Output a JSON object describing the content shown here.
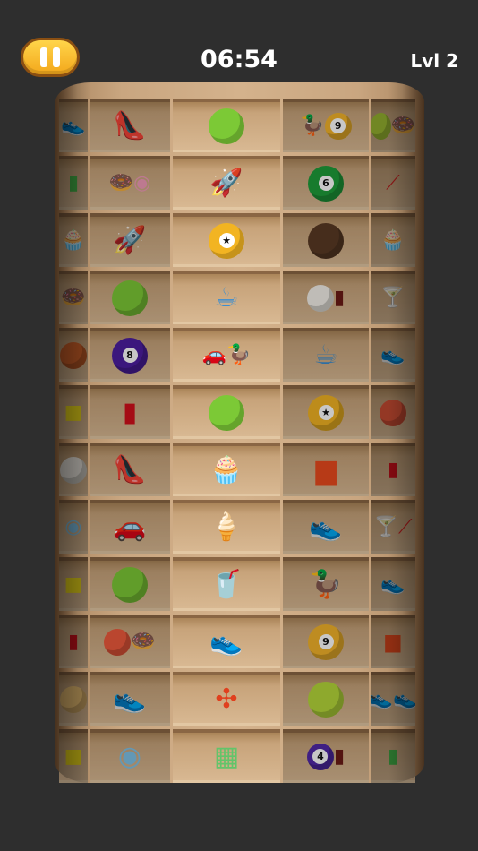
{
  "hud": {
    "pause_icon": "pause-icon",
    "timer": "06:54",
    "level": "Lvl 2"
  },
  "colors": {
    "background": "#2e2e2e",
    "pause_button": "#f5b52a",
    "wood": "#c9a680"
  },
  "tower": {
    "columns": [
      "far-left",
      "left",
      "center",
      "right",
      "far-right"
    ],
    "rows": [
      [
        "sneaker-blue",
        "high-heel-white",
        "bowling-ball-green",
        "rubber-duck|pool-ball-9",
        "tennis-ball|donut-pink"
      ],
      [
        "lighter-green",
        "donut-pink|macaron-pink",
        "rocket",
        "pool-ball-6",
        "candy-cane"
      ],
      [
        "cupcake",
        "rocket",
        "coin-gold",
        "cookie-brown",
        "cupcake"
      ],
      [
        "donut-pink",
        "bowling-ball-green",
        "mug-blue",
        "cake-white|cola-bottle",
        "cocktail-glass"
      ],
      [
        "basketball",
        "pool-ball-8",
        "toy-car-red|rubber-duck",
        "mug-blue",
        "sneaker-blue"
      ],
      [
        "sponge-yellow",
        "cola-can",
        "bowling-ball-green",
        "coin-gold",
        "beach-ball"
      ],
      [
        "egg-white",
        "high-heel-red",
        "cupcake",
        "toy-brick-red",
        "cola-can"
      ],
      [
        "macaron-blue",
        "toy-car-red",
        "ice-cream-cone",
        "sneaker-black",
        "cocktail-glass|candy-cane"
      ],
      [
        "sponge-yellow",
        "bowling-ball-green",
        "cup-green",
        "rubber-duck",
        "sneaker-navy"
      ],
      [
        "cola-can",
        "beach-ball|donut-pink",
        "sneaker-green",
        "pool-ball-9",
        "toy-brick-red"
      ],
      [
        "pie",
        "sneaker-blue",
        "fidget-spinner",
        "tennis-ball",
        "sneaker-green|sneaker-black"
      ],
      [
        "sponge-yellow",
        "macaron-blue",
        "pop-it-toy",
        "pool-ball-4|cola-bottle",
        "lighter-green"
      ]
    ]
  }
}
